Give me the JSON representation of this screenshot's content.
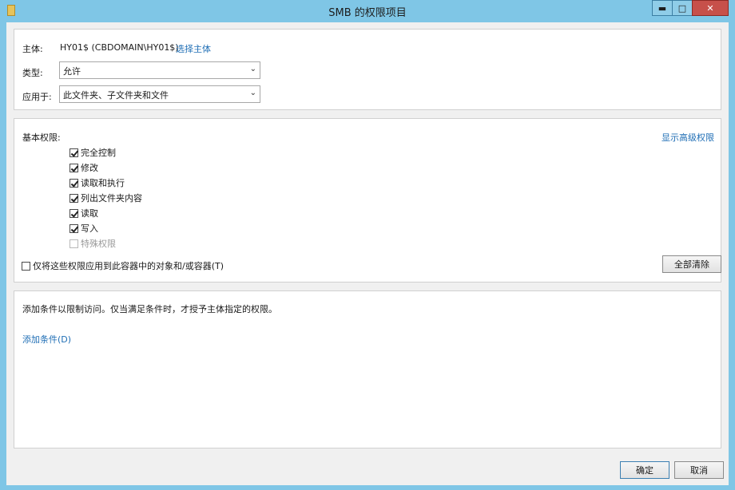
{
  "window": {
    "title": "SMB 的权限项目",
    "minimize_glyph": "▬",
    "maximize_glyph": "□",
    "close_glyph": "✕"
  },
  "principal": {
    "label": "主体:",
    "value": "HY01$ (CBDOMAIN\\HY01$)",
    "select_link": "选择主体"
  },
  "type": {
    "label": "类型:",
    "value": "允许"
  },
  "applies_to": {
    "label": "应用于:",
    "value": "此文件夹、子文件夹和文件"
  },
  "permissions": {
    "label": "基本权限:",
    "advanced_link": "显示高级权限",
    "items": [
      {
        "label": "完全控制",
        "checked": true,
        "disabled": false
      },
      {
        "label": "修改",
        "checked": true,
        "disabled": false
      },
      {
        "label": "读取和执行",
        "checked": true,
        "disabled": false
      },
      {
        "label": "列出文件夹内容",
        "checked": true,
        "disabled": false
      },
      {
        "label": "读取",
        "checked": true,
        "disabled": false
      },
      {
        "label": "写入",
        "checked": true,
        "disabled": false
      },
      {
        "label": "特殊权限",
        "checked": false,
        "disabled": true
      }
    ],
    "apply_only_label": "仅将这些权限应用到此容器中的对象和/或容器(T)",
    "clear_all_button": "全部清除"
  },
  "conditions": {
    "description": "添加条件以限制访问。仅当满足条件时，才授予主体指定的权限。",
    "add_link": "添加条件(D)"
  },
  "footer": {
    "ok_button": "确定",
    "cancel_button": "取消"
  },
  "colors": {
    "frame": "#7fc6e6",
    "link": "#1f6eb5",
    "close_button": "#c7504a"
  }
}
